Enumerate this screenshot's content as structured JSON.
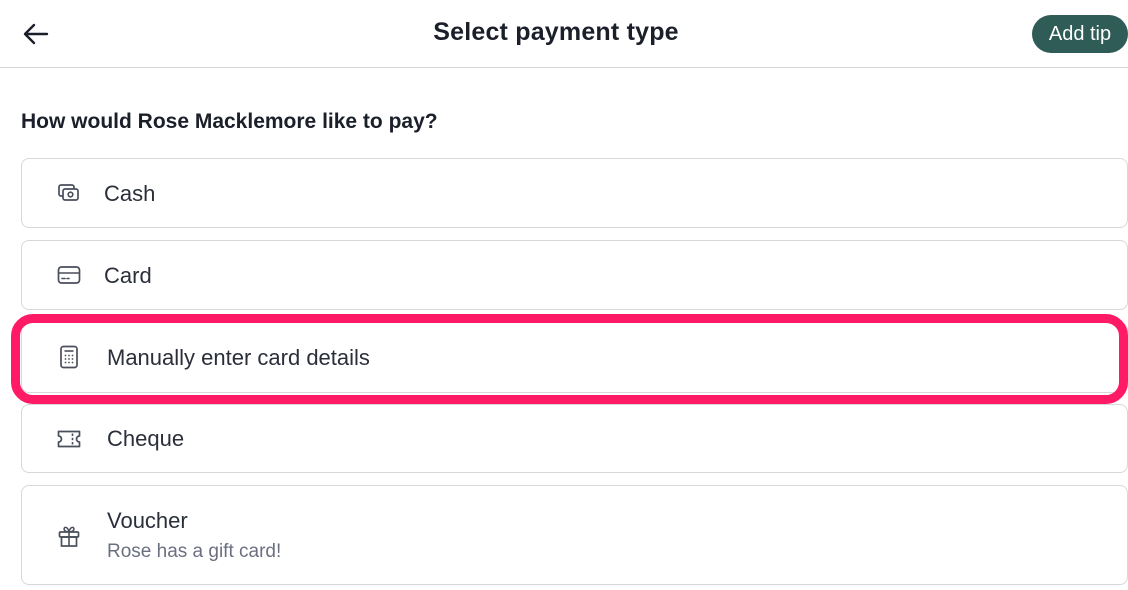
{
  "header": {
    "title": "Select payment type",
    "back_icon": "arrow-left-icon",
    "tip_label": "Add tip",
    "tip_color": "#2f5c57"
  },
  "prompt": "How would Rose Macklemore like to pay?",
  "options": [
    {
      "label": "Cash",
      "icon": "cash-icon"
    },
    {
      "label": "Card",
      "icon": "credit-card-icon"
    },
    {
      "label": "Manually enter card details",
      "icon": "keypad-icon",
      "highlighted": true
    },
    {
      "label": "Cheque",
      "icon": "ticket-icon"
    },
    {
      "label": "Voucher",
      "sublabel": "Rose has a gift card!",
      "icon": "gift-icon"
    }
  ],
  "highlight_color": "#ff1a66"
}
